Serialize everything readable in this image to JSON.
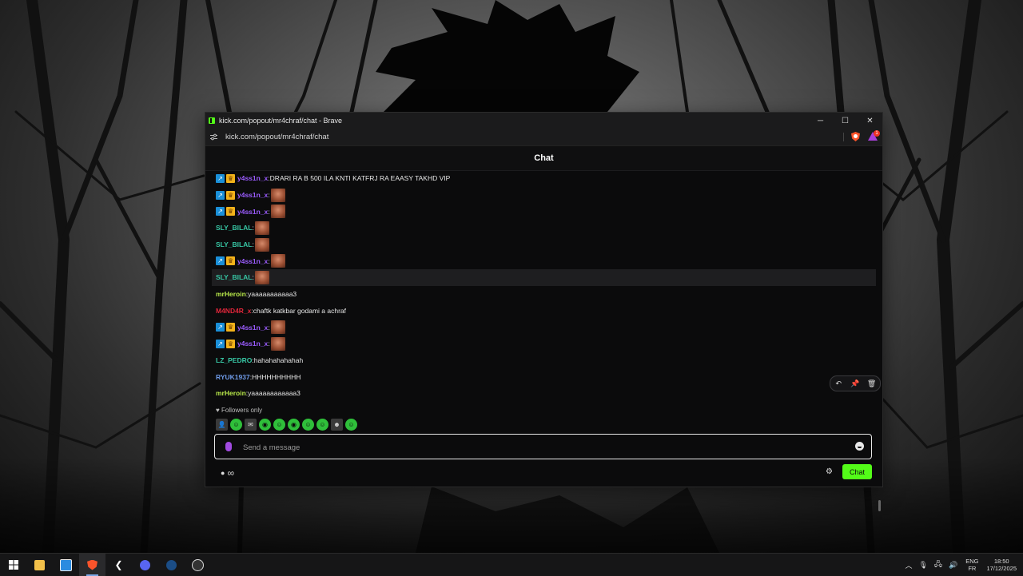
{
  "window": {
    "title": "kick.com/popout/mr4chraf/chat - Brave",
    "url": "kick.com/popout/mr4chraf/chat",
    "controls": {
      "minimize": "─",
      "maximize": "☐",
      "close": "✕"
    },
    "rewards_count": "1"
  },
  "chat": {
    "header": "Chat",
    "messages": [
      {
        "user": "y4ss1n_x",
        "user_color": "#9b5cff",
        "badges": true,
        "text": "DRARI RA B 500 ILA KNTI KATFRJ RA EAASY TAKHD VIP",
        "emote": false
      },
      {
        "user": "y4ss1n_x",
        "user_color": "#9b5cff",
        "badges": true,
        "text": "",
        "emote": true
      },
      {
        "user": "y4ss1n_x",
        "user_color": "#9b5cff",
        "badges": true,
        "text": "",
        "emote": true
      },
      {
        "user": "SLY_BILAL",
        "user_color": "#37c6a4",
        "badges": false,
        "text": "",
        "emote": true
      },
      {
        "user": "SLY_BILAL",
        "user_color": "#37c6a4",
        "badges": false,
        "text": "",
        "emote": true
      },
      {
        "user": "y4ss1n_x",
        "user_color": "#9b5cff",
        "badges": true,
        "text": "",
        "emote": true
      },
      {
        "user": "SLY_BILAL",
        "user_color": "#37c6a4",
        "badges": false,
        "text": "",
        "emote": true
      },
      {
        "user": "mrHeroin",
        "user_color": "#b9e94a",
        "badges": false,
        "text": "yaaaaaaaaaaa3",
        "emote": false
      },
      {
        "user": "M4ND4R_x",
        "user_color": "#e0263a",
        "badges": false,
        "text": "chaftk katkbar godami a achraf",
        "emote": false
      },
      {
        "user": "y4ss1n_x",
        "user_color": "#9b5cff",
        "badges": true,
        "text": "",
        "emote": true
      },
      {
        "user": "y4ss1n_x",
        "user_color": "#9b5cff",
        "badges": true,
        "text": "",
        "emote": true
      },
      {
        "user": "LZ_PEDRO",
        "user_color": "#37c6a4",
        "badges": false,
        "text": "hahahahahahah",
        "emote": false
      },
      {
        "user": "RYUK1937",
        "user_color": "#6f9be8",
        "badges": false,
        "text": "HHHHHHHHHH",
        "emote": false
      },
      {
        "user": "mrHeroin",
        "user_color": "#b9e94a",
        "badges": false,
        "text": "yaaaaaaaaaaaa3",
        "emote": false
      }
    ],
    "hovered_index": 6,
    "hover_actions": [
      "↶",
      "📌",
      "🗑"
    ],
    "followers_only": "Followers only",
    "input_placeholder": "Send a message",
    "send_label": "Chat",
    "bottom_icons": "∞"
  },
  "colors": {
    "accent": "#53fc18",
    "background": "#0b0b0c"
  },
  "taskbar": {
    "apps": [
      "windows-start",
      "file-explorer",
      "microsoft-store",
      "brave",
      "app-back",
      "discord",
      "steam",
      "obs"
    ],
    "lang_top": "ENG",
    "lang_bottom": "FR",
    "time": "18:50",
    "date": "17/12/2025"
  }
}
